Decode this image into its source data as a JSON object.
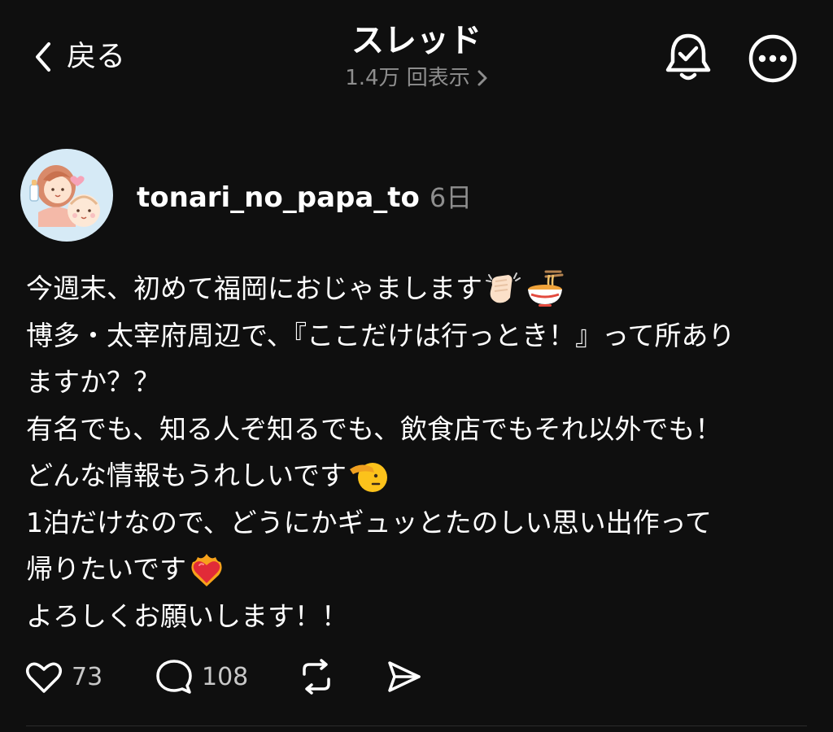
{
  "header": {
    "back_label": "戻る",
    "title": "スレッド",
    "views": "1.4万 回表示"
  },
  "post": {
    "author": "tonari_no_papa_to",
    "time_ago": "6日",
    "lines": [
      "今週末、初めて福岡におじゃまします",
      "博多・太宰府周辺で、『ここだけは行っとき！』って所あり",
      "ますか？？",
      "有名でも、知る人ぞ知るでも、飲食店でもそれ以外でも！",
      "どんな情報もうれしいです",
      "1泊だけなので、どうにかギュッとたのしい思い出作って",
      "帰りたいです",
      "よろしくお願いします！！"
    ],
    "emojis": {
      "line1": [
        "clapping-hands-emoji",
        "ramen-bowl-emoji"
      ],
      "line5": [
        "saluting-face-emoji"
      ],
      "line7": [
        "heart-on-fire-emoji"
      ]
    }
  },
  "actions": {
    "likes": "73",
    "replies": "108"
  },
  "icons": {
    "back": "chevron-left-icon",
    "views_arrow": "chevron-right-icon",
    "notify": "bell-check-icon",
    "more": "more-circle-icon",
    "like": "heart-icon",
    "reply": "comment-icon",
    "repost": "repost-icon",
    "share": "send-icon"
  },
  "colors": {
    "background": "#0f0f0f",
    "text": "#ffffff",
    "muted": "#8e8e8e",
    "avatar_bg": "#d6eaf6"
  }
}
